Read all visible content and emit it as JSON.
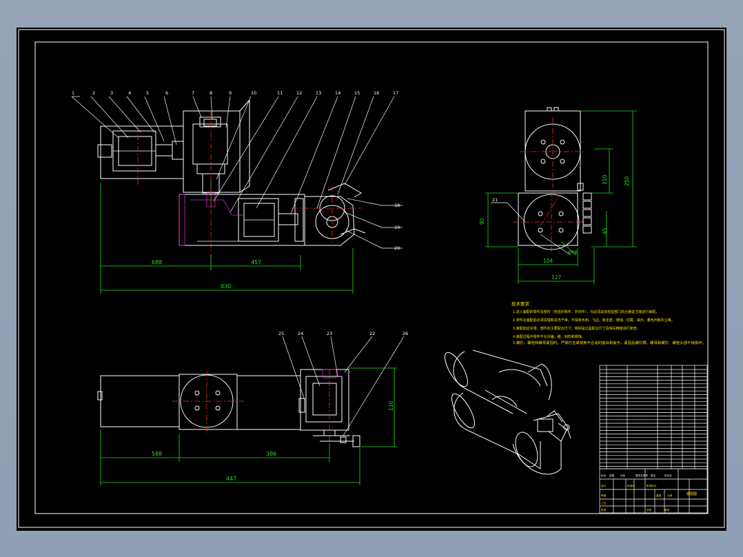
{
  "drawing": {
    "balloons_top": [
      "1",
      "2",
      "3",
      "4",
      "5",
      "6",
      "7",
      "8",
      "9",
      "10",
      "11",
      "12",
      "13",
      "14",
      "15",
      "16",
      "17"
    ],
    "balloons_right": [
      "18",
      "19",
      "20"
    ],
    "balloon_side": "21",
    "balloons_bottom": [
      "25",
      "24",
      "23",
      "22",
      "26"
    ],
    "dims_front": {
      "d_left": "688",
      "d_mid": "457",
      "d_total": "830"
    },
    "dims_side": {
      "h_total": "250",
      "h_upper": "110",
      "h_lower": "45",
      "h_left": "90",
      "w_inner": "104",
      "w_outer": "127",
      "dia": "Ø88"
    },
    "dims_top": {
      "d_left": "588",
      "d_mid": "386",
      "d_total": "447",
      "h_right": "110"
    }
  },
  "notes": {
    "title": "技术要求",
    "lines": [
      "1.进入装配的零件及部件（包括外购件、外协件），均必须具有检验部门的合格证方能进行装配。",
      "2.零件在装配前必须清理和清洗干净，不得有毛刺、飞边、氧化皮、锈蚀、切屑、油污、着色剂和灰尘等。",
      "3.装配前应对零、部件的主要配合尺寸，特别是过盈配合尺寸及相关精度进行复查。",
      "4.装配过程中零件不允许磕、碰、划伤和锈蚀。",
      "5.螺钉、螺栓和螺母紧固时，严禁打击或使用不合适的旋具和扳手。紧固后螺钉槽、螺母和螺钉、螺栓头部不得损坏。"
    ]
  },
  "title_block": {
    "labels": [
      "标记",
      "处数",
      "分区",
      "更改文件号",
      "签名",
      "年月日",
      "设计",
      "标准化",
      "阶段标记",
      "重量",
      "比例",
      "审核",
      "工艺",
      "批准",
      "共张",
      "第张"
    ],
    "drawing_name": "装配图"
  },
  "colors": {
    "background": "#000000",
    "frame": "#ffffff",
    "dimension": "#22e022",
    "centerline": "#ff2a2a",
    "hatch": "#d22ad2"
  }
}
